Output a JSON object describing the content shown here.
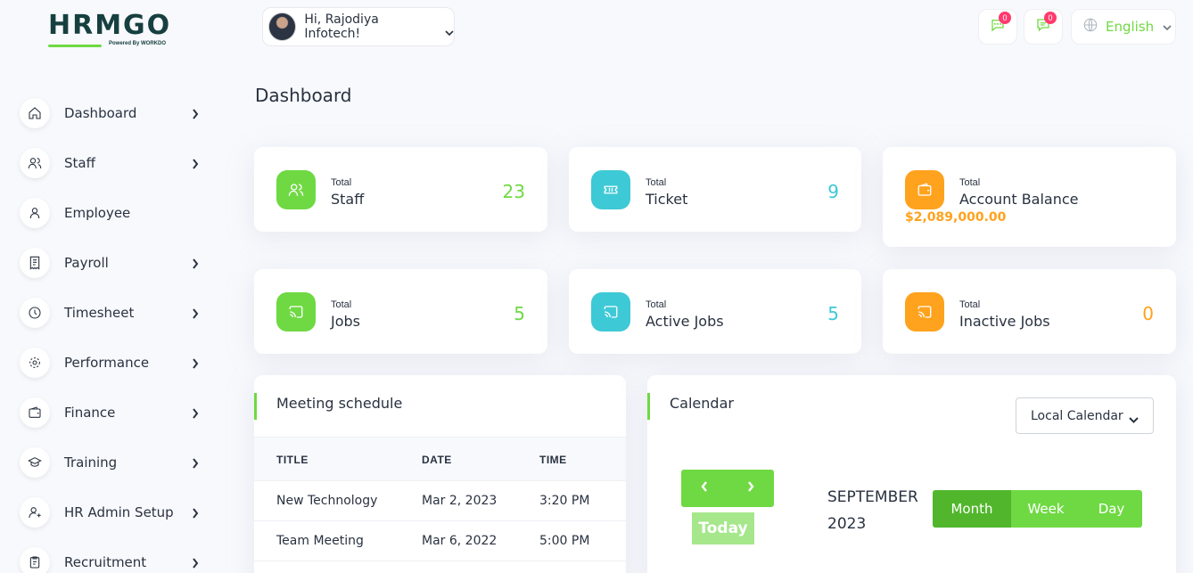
{
  "brand": {
    "logo_text": "HRMGO",
    "logo_sub": "Powered By WORKDO",
    "accent": "#6fd943"
  },
  "sidebar": {
    "items": [
      {
        "label": "Dashboard",
        "icon": "home-icon",
        "has_submenu": true
      },
      {
        "label": "Staff",
        "icon": "users-icon",
        "has_submenu": true
      },
      {
        "label": "Employee",
        "icon": "user-icon",
        "has_submenu": false
      },
      {
        "label": "Payroll",
        "icon": "receipt-icon",
        "has_submenu": true
      },
      {
        "label": "Timesheet",
        "icon": "clock-icon",
        "has_submenu": true
      },
      {
        "label": "Performance",
        "icon": "target-icon",
        "has_submenu": true
      },
      {
        "label": "Finance",
        "icon": "wallet-icon",
        "has_submenu": true
      },
      {
        "label": "Training",
        "icon": "graduation-cap-icon",
        "has_submenu": true
      },
      {
        "label": "HR Admin Setup",
        "icon": "user-plus-icon",
        "has_submenu": true
      },
      {
        "label": "Recruitment",
        "icon": "clipboard-icon",
        "has_submenu": true
      }
    ]
  },
  "header": {
    "greeting": "Hi, Rajodiya Infotech!",
    "messages_count": "0",
    "notifications_count": "0",
    "language": "English"
  },
  "page": {
    "title": "Dashboard"
  },
  "stats": [
    {
      "small": "Total",
      "label": "Staff",
      "value": "23",
      "color": "#6fd943",
      "icon": "users-icon"
    },
    {
      "small": "Total",
      "label": "Ticket",
      "value": "9",
      "color": "#3ec9d6",
      "icon": "ticket-icon"
    },
    {
      "small": "Total",
      "label": "Account Balance",
      "value": "$2,089,000.00",
      "color": "#ffa21d",
      "icon": "wallet-icon"
    },
    {
      "small": "Total",
      "label": "Jobs",
      "value": "5",
      "color": "#6fd943",
      "icon": "cast-icon"
    },
    {
      "small": "Total",
      "label": "Active Jobs",
      "value": "5",
      "color": "#3ec9d6",
      "icon": "cast-icon"
    },
    {
      "small": "Total",
      "label": "Inactive Jobs",
      "value": "0",
      "color": "#ffa21d",
      "icon": "cast-icon"
    }
  ],
  "meeting": {
    "title": "Meeting schedule",
    "columns": [
      "TITLE",
      "DATE",
      "TIME"
    ],
    "rows": [
      [
        "New Technology",
        "Mar 2, 2023",
        "3:20 PM"
      ],
      [
        "Team Meeting",
        "Mar 6, 2022",
        "5:00 PM"
      ]
    ]
  },
  "calendar": {
    "title": "Calendar",
    "source": "Local Calendar",
    "today_label": "Today",
    "month_line1": "SEPTEMBER",
    "month_line2": "2023",
    "views": [
      "Month",
      "Week",
      "Day"
    ],
    "active_view": "Month"
  }
}
